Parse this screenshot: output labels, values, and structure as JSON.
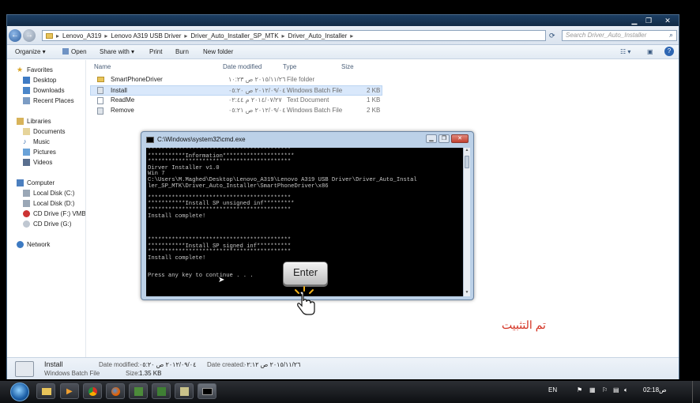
{
  "window": {
    "controls": {
      "minimize": "▁",
      "maximize": "❐",
      "close": "✕"
    },
    "breadcrumb": [
      "Lenovo_A319",
      "Lenovo A319 USB Driver",
      "Driver_Auto_Installer_SP_MTK",
      "Driver_Auto_Installer"
    ],
    "breadcrumb_sep": "▸",
    "search_placeholder": "Search Driver_Auto_Installer"
  },
  "toolbar": {
    "organize": "Organize ▾",
    "open": "Open",
    "share_with": "Share with ▾",
    "print": "Print",
    "burn": "Burn",
    "new_folder": "New folder"
  },
  "sidebar": {
    "favorites": {
      "label": "Favorites",
      "items": [
        "Desktop",
        "Downloads",
        "Recent Places"
      ]
    },
    "libraries": {
      "label": "Libraries",
      "items": [
        "Documents",
        "Music",
        "Pictures",
        "Videos"
      ]
    },
    "computer": {
      "label": "Computer",
      "items": [
        "Local Disk (C:)",
        "Local Disk (D:)",
        "CD Drive (F:) VMB Li",
        "CD Drive (G:)"
      ]
    },
    "network": {
      "label": "Network"
    }
  },
  "file_list": {
    "columns": [
      "Name",
      "Date modified",
      "Type",
      "Size"
    ],
    "rows": [
      {
        "name": "SmartPhoneDriver",
        "date": "٢٠١٥/١١/٢٦ ص ١٠:٢٣",
        "type": "File folder",
        "size": ""
      },
      {
        "name": "Install",
        "date": "٢٠١٢/٠٩/٠٤ ص ٠٥:٢٠",
        "type": "Windows Batch File",
        "size": "2 KB"
      },
      {
        "name": "ReadMe",
        "date": "٢٠١٤/٠٧/٢٧ م ٠٢:٤٤",
        "type": "Text Document",
        "size": "1 KB"
      },
      {
        "name": "Remove",
        "date": "٢٠١٢/٠٩/٠٤ ص ٠٥:٢١",
        "type": "Windows Batch File",
        "size": "2 KB"
      }
    ]
  },
  "details": {
    "name": "Install",
    "type": "Windows Batch File",
    "date_modified_label": "Date modified:",
    "date_modified": "٢٠١٢/٠٩/٠٤ ص ٠٥:٢٠",
    "size_label": "Size:",
    "size": "1.35 KB",
    "date_created_label": "Date created:",
    "date_created": "٢٠١٥/١١/٢٦ ص ٠٢:١٢"
  },
  "cmd": {
    "title": "C:\\Windows\\system32\\cmd.exe",
    "lines": [
      "******************************************",
      "***********Information*********************",
      "******************************************",
      "Dirver Installer v1.0",
      "Win 7",
      "C:\\Users\\M.Maghed\\Desktop\\Lenovo_A319\\Lenovo A319 USB Driver\\Driver_Auto_Instal",
      "ler_SP_MTK\\Driver_Auto_Installer\\SmartPhoneDriver\\x86",
      "",
      "******************************************",
      "***********Install SP unsigned inf*********",
      "******************************************",
      "Install complete!",
      "",
      "",
      "",
      "******************************************",
      "***********Install SP signed inf**********",
      "******************************************",
      "Install complete!",
      "",
      "",
      "Press any key to continue . . ."
    ]
  },
  "overlay": {
    "key_label": "Enter",
    "caption": "تم التثبيت"
  },
  "taskbar": {
    "language": "EN",
    "time": "02:18",
    "ampm": "ص"
  },
  "colors": {
    "caption": "#d32e1e",
    "taskbar": "#1a1c20",
    "selection": "#d9e8fb"
  }
}
